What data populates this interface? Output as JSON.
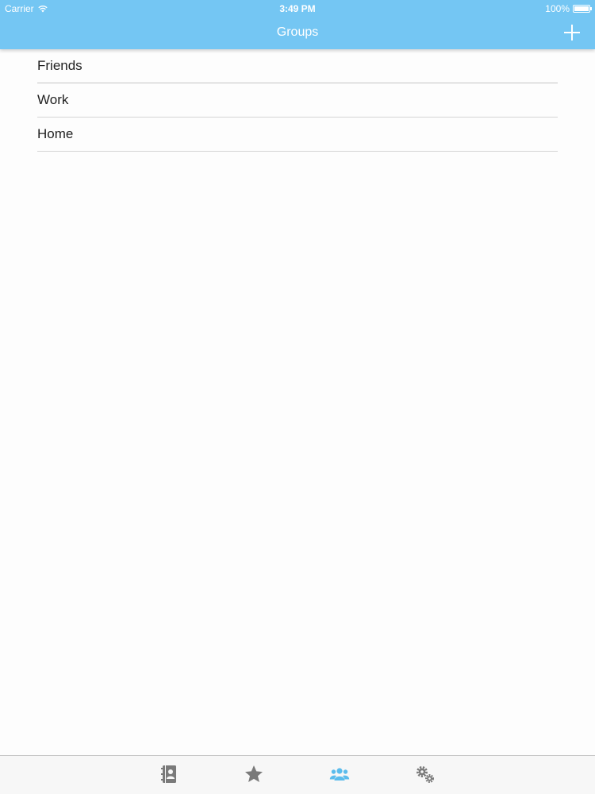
{
  "status_bar": {
    "carrier": "Carrier",
    "time": "3:49 PM",
    "battery": "100%"
  },
  "nav": {
    "title": "Groups",
    "add_icon": "plus-icon"
  },
  "groups": [
    {
      "label": "Friends"
    },
    {
      "label": "Work"
    },
    {
      "label": "Home"
    }
  ],
  "tab_bar": {
    "tabs": [
      {
        "icon": "contacts-book-icon",
        "selected": false
      },
      {
        "icon": "star-icon",
        "selected": false
      },
      {
        "icon": "group-icon",
        "selected": true
      },
      {
        "icon": "gears-icon",
        "selected": false
      }
    ]
  },
  "colors": {
    "accent": "#74c6f3",
    "tab_selected": "#5bbcec",
    "tab_unselected": "#7a7a7a"
  }
}
